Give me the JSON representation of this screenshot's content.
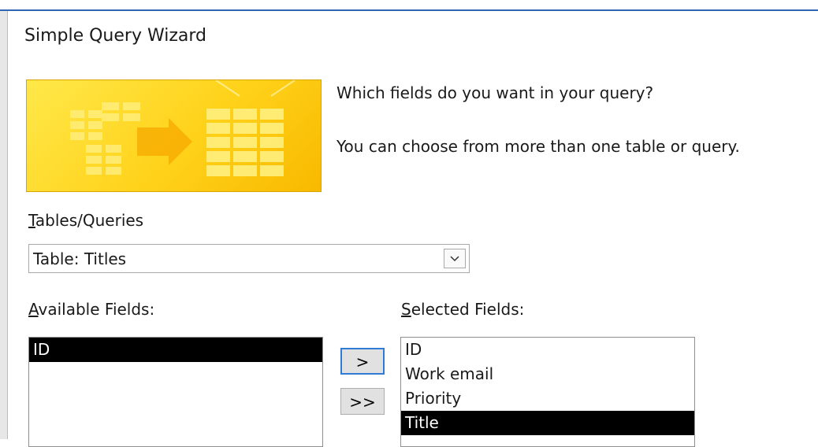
{
  "dialog": {
    "title": "Simple Query Wizard",
    "prompt_question": "Which fields do you want in your query?",
    "prompt_hint": "You can choose from more than one table or query."
  },
  "tables_queries": {
    "label": "Tables/Queries",
    "selected": "Table: Titles"
  },
  "available_fields": {
    "label": "Available Fields:",
    "items": [
      "ID"
    ],
    "selected_index": 0
  },
  "selected_fields": {
    "label": "Selected Fields:",
    "items": [
      "ID",
      "Work email",
      "Priority",
      "Title"
    ],
    "selected_index": 3
  },
  "buttons": {
    "add_one": ">",
    "add_all": ">>"
  },
  "colors": {
    "banner_yellow": "#ffd21a",
    "selection": "#000000",
    "focus_border": "#2f7bd6"
  }
}
